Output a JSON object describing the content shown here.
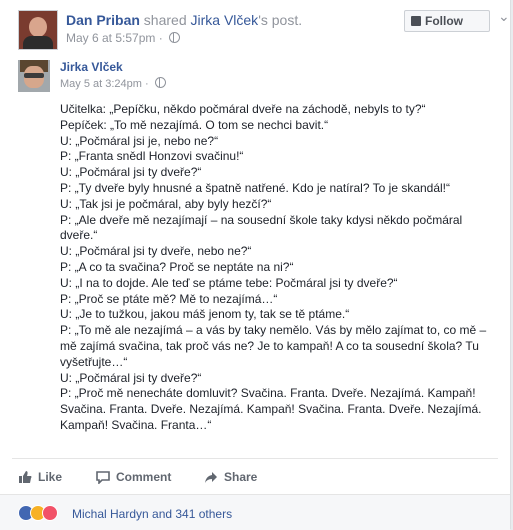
{
  "header": {
    "sharer_name": "Dan Priban",
    "shared_text": "shared",
    "original_author": "Jirka Vlček",
    "post_suffix": "'s post.",
    "timestamp": "May 6 at 5:57pm",
    "separator": "·",
    "follow_label": "Follow"
  },
  "shared_post": {
    "author": "Jirka Vlček",
    "timestamp": "May 5 at 3:24pm",
    "separator": "·",
    "lines": [
      "Učitelka: „Pepíčku, někdo počmáral dveře na záchodě, nebyls to ty?“",
      "Pepíček: „To mě nezajímá. O tom se nechci bavit.“",
      "U: „Počmáral jsi je, nebo ne?“",
      "P: „Franta snědl Honzovi svačinu!“",
      "U: „Počmáral jsi ty dveře?“",
      "P: „Ty dveře byly hnusné a špatně natřené. Kdo je natíral? To je skandál!“",
      "U: „Tak jsi je počmáral, aby byly hezčí?“",
      "P: „Ale dveře mě nezajímají – na sousední škole taky kdysi někdo počmáral dveře.“",
      "U: „Počmáral jsi ty dveře, nebo ne?“",
      "P: „A co ta svačina? Proč se neptáte na ni?“",
      "U: „I na to dojde. Ale teď se ptáme tebe: Počmáral jsi ty dveře?“",
      "P: „Proč se ptáte mě? Mě to nezajímá…“",
      "U: „Je to tužkou, jakou máš jenom ty, tak se tě ptáme.“",
      "P: „To mě ale nezajímá – a vás by taky nemělo. Vás by mělo zajímat to, co mě – mě zajímá svačina, tak proč vás ne? Je to kampaň! A co ta sousední škola? Tu vyšetřujte…“",
      "U: „Počmáral jsi ty dveře?“",
      "P: „Proč mě nenecháte domluvit? Svačina. Franta. Dveře. Nezajímá. Kampaň! Svačina. Franta. Dveře. Nezajímá. Kampaň! Svačina. Franta. Dveře. Nezajímá. Kampaň! Svačina. Franta…“"
    ]
  },
  "actions": {
    "like": "Like",
    "comment": "Comment",
    "share": "Share"
  },
  "reactions": {
    "icons": [
      "like-reaction-icon",
      "haha-reaction-icon",
      "love-reaction-icon"
    ],
    "summary": "Michal Hardyn and 341 others"
  }
}
